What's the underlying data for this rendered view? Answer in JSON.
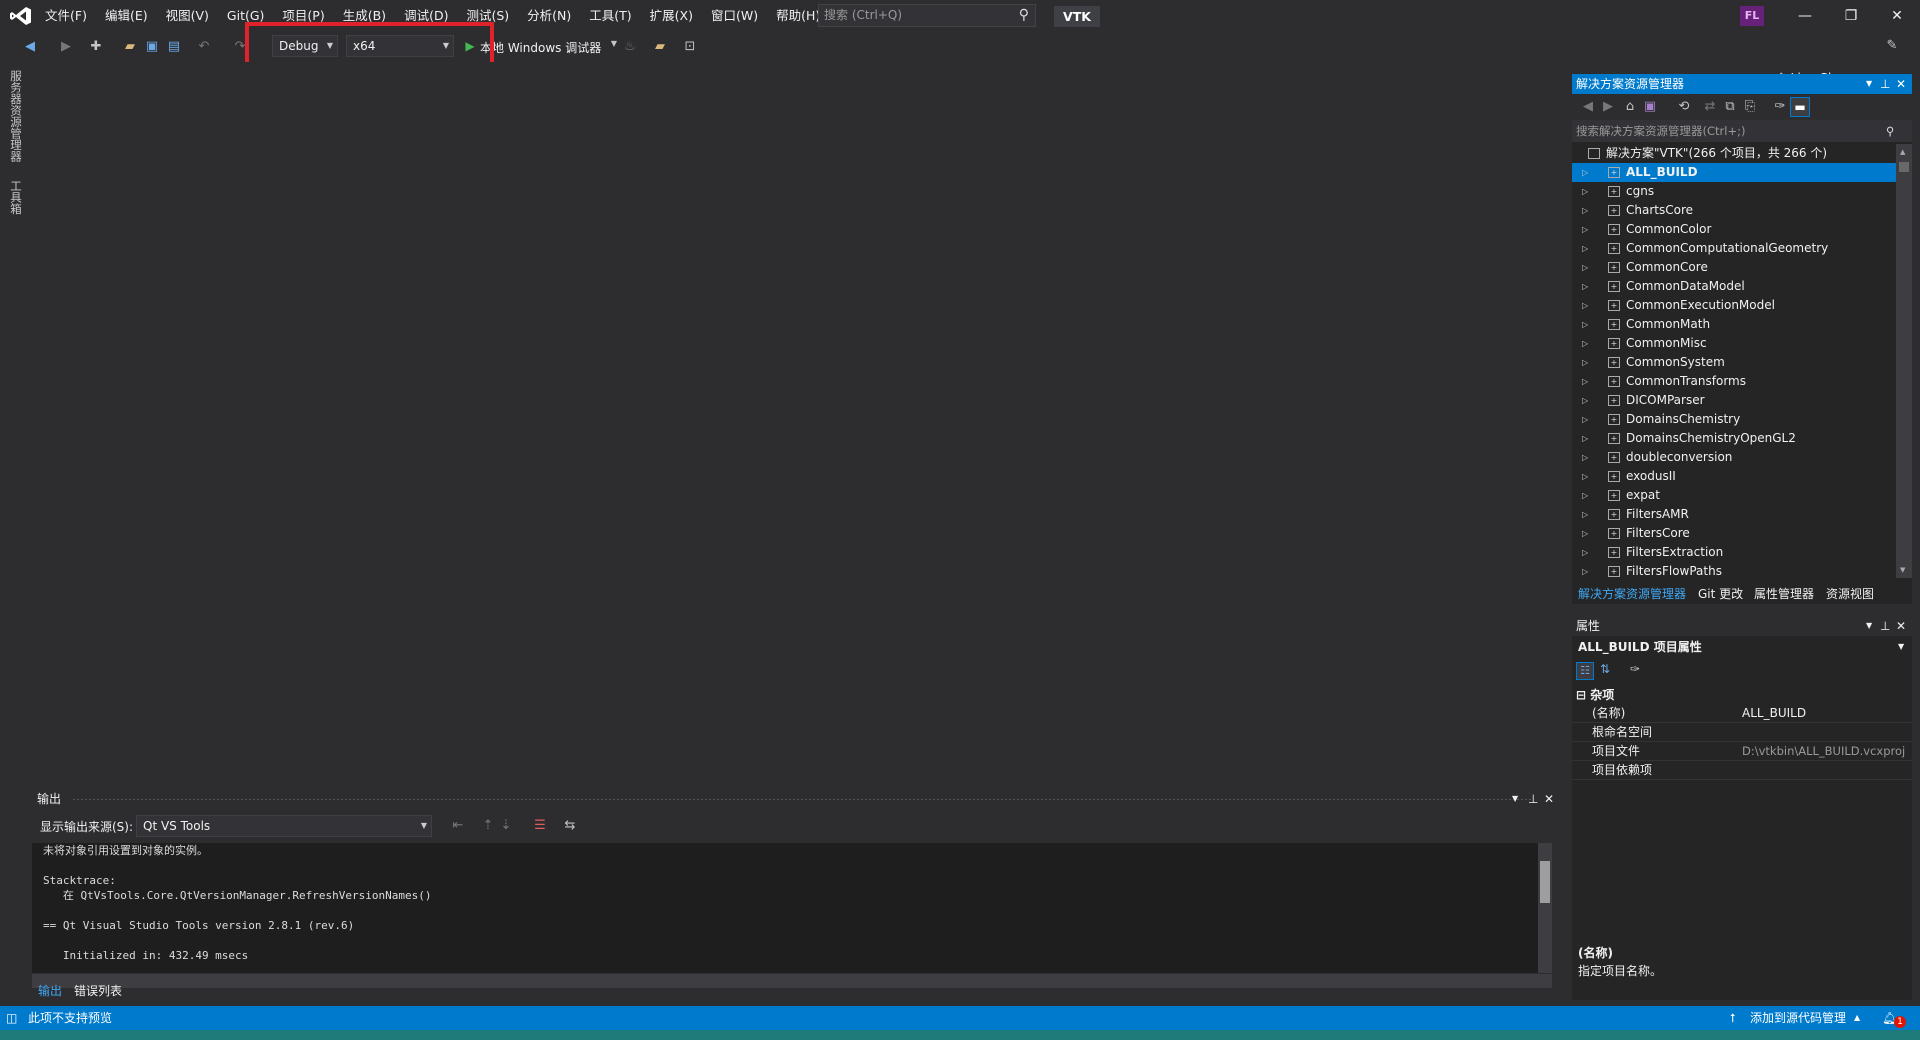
{
  "menu": [
    "文件(F)",
    "编辑(E)",
    "视图(V)",
    "Git(G)",
    "项目(P)",
    "生成(B)",
    "调试(D)",
    "测试(S)",
    "分析(N)",
    "工具(T)",
    "扩展(X)",
    "窗口(W)",
    "帮助(H)"
  ],
  "search": {
    "placeholder": "搜索 (Ctrl+Q)"
  },
  "solution_name": "VTK",
  "user_initials": "FL",
  "window_controls": {
    "minimize": "—",
    "restore": "❐",
    "close": "✕"
  },
  "toolbar": {
    "config": "Debug",
    "platform": "x64",
    "run_label": "本地 Windows 调试器",
    "live_share": "Live Share"
  },
  "left_strip": {
    "server_explorer": "服务器资源管理器",
    "toolbox": "工具箱"
  },
  "output": {
    "title": "输出",
    "source_label": "显示输出来源(S):",
    "source_value": "Qt VS Tools",
    "lines": [
      "未将对象引用设置到对象的实例。",
      "",
      "Stacktrace:",
      "   在 QtVsTools.Core.QtVersionManager.RefreshVersionNames()",
      "",
      "== Qt Visual Studio Tools version 2.8.1 (rev.6)",
      "",
      "   Initialized in: 432.49 msecs"
    ],
    "tabs": [
      "输出",
      "错误列表"
    ]
  },
  "solution_explorer": {
    "title": "解决方案资源管理器",
    "search_placeholder": "搜索解决方案资源管理器(Ctrl+;)",
    "root": "解决方案\"VTK\"(266 个项目，共 266 个)",
    "items": [
      "ALL_BUILD",
      "cgns",
      "ChartsCore",
      "CommonColor",
      "CommonComputationalGeometry",
      "CommonCore",
      "CommonDataModel",
      "CommonExecutionModel",
      "CommonMath",
      "CommonMisc",
      "CommonSystem",
      "CommonTransforms",
      "DICOMParser",
      "DomainsChemistry",
      "DomainsChemistryOpenGL2",
      "doubleconversion",
      "exodusII",
      "expat",
      "FiltersAMR",
      "FiltersCore",
      "FiltersExtraction",
      "FiltersFlowPaths"
    ],
    "selected": "ALL_BUILD",
    "tabs": [
      "解决方案资源管理器",
      "Git 更改",
      "属性管理器",
      "资源视图"
    ]
  },
  "properties": {
    "title": "属性",
    "object": "ALL_BUILD 项目属性",
    "category": "杂项",
    "rows": [
      {
        "key": "(名称)",
        "value": "ALL_BUILD"
      },
      {
        "key": "根命名空间",
        "value": ""
      },
      {
        "key": "项目文件",
        "value": "D:\\vtkbin\\ALL_BUILD.vcxproj"
      },
      {
        "key": "项目依赖项",
        "value": ""
      }
    ],
    "desc_title": "(名称)",
    "desc_text": "指定项目名称。"
  },
  "status": {
    "left": "此项不支持预览",
    "right": "添加到源代码管理",
    "notif_count": "1"
  },
  "colors": {
    "accent": "#007acc",
    "highlight": "#e0222b",
    "bg": "#2d2d30"
  }
}
